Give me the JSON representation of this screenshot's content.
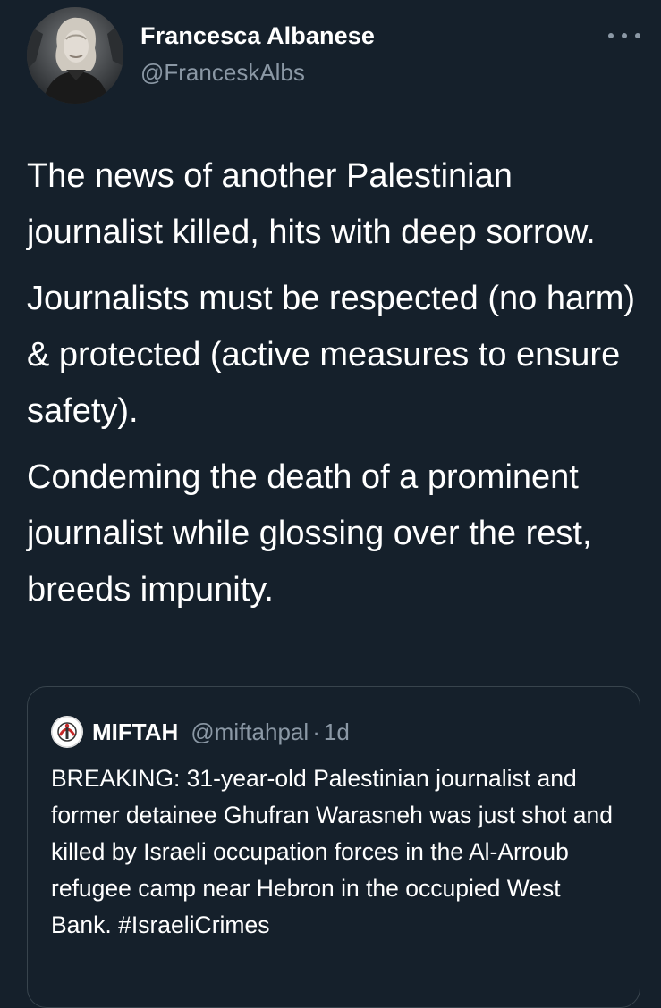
{
  "author": {
    "name": "Francesca Albanese",
    "handle": "@FranceskAlbs"
  },
  "tweet": {
    "paragraphs": [
      "The news of another Palestinian journalist killed, hits with deep sorrow.",
      "Journalists must be respected (no harm) & protected (active measures to ensure safety).",
      "Condeming the death of a prominent journalist while glossing over the rest,  breeds impunity."
    ]
  },
  "quoted": {
    "name": "MIFTAH",
    "handle": "@miftahpal",
    "separator": "·",
    "time": "1d",
    "text": "BREAKING: 31-year-old Palestinian journalist and former detainee Ghufran Warasneh was just shot and killed by Israeli occupation forces in the Al-Arroub refugee camp near Hebron in the occupied West Bank. #IsraeliCrimes"
  },
  "colors": {
    "background": "#15202b",
    "text_primary": "#ffffff",
    "text_secondary": "#8b98a5",
    "border": "#38444d"
  },
  "icons": {
    "more": "more-horizontal-icon"
  }
}
